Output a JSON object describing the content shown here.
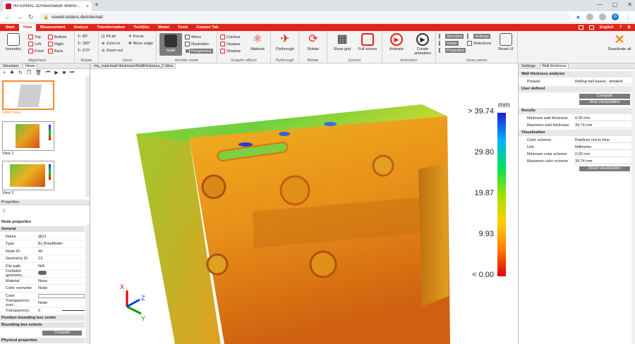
{
  "browser": {
    "tab_title": "INTERNAL 3DViewStation WebVi...",
    "url": "vsweb.kisters.de/internal/",
    "profile_initial": "G"
  },
  "menu": {
    "tabs": [
      "Start",
      "View",
      "Measurement",
      "Analyze",
      "Transformation",
      "TechDoc",
      "Model",
      "Tools",
      "Custom Tab"
    ],
    "active": "View",
    "language": "English"
  },
  "ribbon": {
    "alignment": {
      "label": "Alignment",
      "isometric": "Isometric",
      "top": "Top",
      "bottom": "Bottom",
      "left": "Left",
      "right": "Right",
      "front": "Front",
      "back": "Back"
    },
    "rotate": {
      "label": "Rotate",
      "r90": "90°",
      "r180": "180°",
      "r270": "270°"
    },
    "zoom": {
      "label": "Zoom",
      "fit_all": "Fit all",
      "zoom_in": "Zoom in",
      "zoom_out": "Zoom out",
      "focus": "Focus",
      "move_origin": "Move origin"
    },
    "render_mode": {
      "label": "Render mode",
      "solid": "Solid",
      "wires": "Wires",
      "illustration": "Illustration",
      "perspective": "Perspective"
    },
    "graphic_effects": {
      "label": "Graphic effects",
      "contour": "Contour",
      "opaque": "Opaque",
      "shadow": "Shadow",
      "material": "Material"
    },
    "flythrough": {
      "label": "Flythrough",
      "button": "Flythrough"
    },
    "rotate2": {
      "label": "Rotate",
      "button": "Rotate"
    },
    "scenes": {
      "label": "Scenes",
      "show_grid": "Show grid",
      "full_screen": "Full screen"
    },
    "animation": {
      "label": "Animation",
      "animate": "Animate",
      "create_animation": "Create animation"
    },
    "show_panes": {
      "label": "Show panes",
      "structure": "Structure",
      "views": "Views",
      "properties": "Properties",
      "settings": "Settings",
      "selections": "Selections",
      "reset_ui": "Reset UI"
    },
    "deactivate": "Deactivate all"
  },
  "structure_panel": {
    "tabs": [
      "Structure",
      "Views"
    ],
    "views": [
      {
        "label": "Initial View"
      },
      {
        "label": "View 1"
      },
      {
        "label": "View 2"
      }
    ]
  },
  "properties_panel": {
    "title": "Properties",
    "node_properties": "Node properties",
    "general": "General",
    "rows": [
      {
        "k": "Name",
        "v": "@21"
      },
      {
        "k": "Type",
        "v": "Bi_BrepModel"
      },
      {
        "k": "Node ID",
        "v": "49"
      },
      {
        "k": "Geometry ID",
        "v": "13"
      },
      {
        "k": "File path",
        "v": "N/A"
      },
      {
        "k": "Contains geometry...",
        "v": ""
      },
      {
        "k": "Material",
        "v": "None"
      },
      {
        "k": "Color overwrite",
        "v": "Node"
      },
      {
        "k": "Color",
        "v": ""
      },
      {
        "k": "Transparency over...",
        "v": "Node"
      },
      {
        "k": "Transparency",
        "v": "0"
      }
    ],
    "pos_bbox": "Position bounding box center",
    "bbox_extents": "Bounding box extents",
    "compute": "Compute",
    "physical": "Physical properties"
  },
  "viewport": {
    "tab": "+by_topic/wall thickness/Wallthickness_2.3dvs",
    "legend": {
      "unit": "mm",
      "ticks": [
        "> 39.74",
        "29.80",
        "19.87",
        "9.93",
        "< 0.00"
      ]
    },
    "axes": {
      "x": "X",
      "y": "Y",
      "z": "Z"
    }
  },
  "settings_panel": {
    "tabs": [
      "Settings",
      "Wall thickness"
    ],
    "wall_thickness_analysis": "Wall thickness analysis",
    "presets_label": "Presets",
    "presets_value": "Rolling ball based - detailed",
    "user_defined": "User defined",
    "compute": "Compute",
    "stop": "Stop computation",
    "results": "Results",
    "min_wall_label": "Minimum wall thickness",
    "min_wall_value": "0.00 mm",
    "max_wall_label": "Maximum wall thickness",
    "max_wall_value": "39.74 mm",
    "visualization": "Visualization",
    "color_scheme_label": "Color scheme",
    "color_scheme_value": "Rainbow red to blue",
    "unit_label": "Unit",
    "unit_value": "Millimeter",
    "min_color_label": "Minimum color scheme",
    "min_color_value": "0.00 mm",
    "max_color_label": "Maximum color scheme",
    "max_color_value": "39.74 mm",
    "reset_vis": "Reset visualization"
  },
  "colors": {
    "accent": "#e2231a",
    "highlight": "#f28c28"
  }
}
